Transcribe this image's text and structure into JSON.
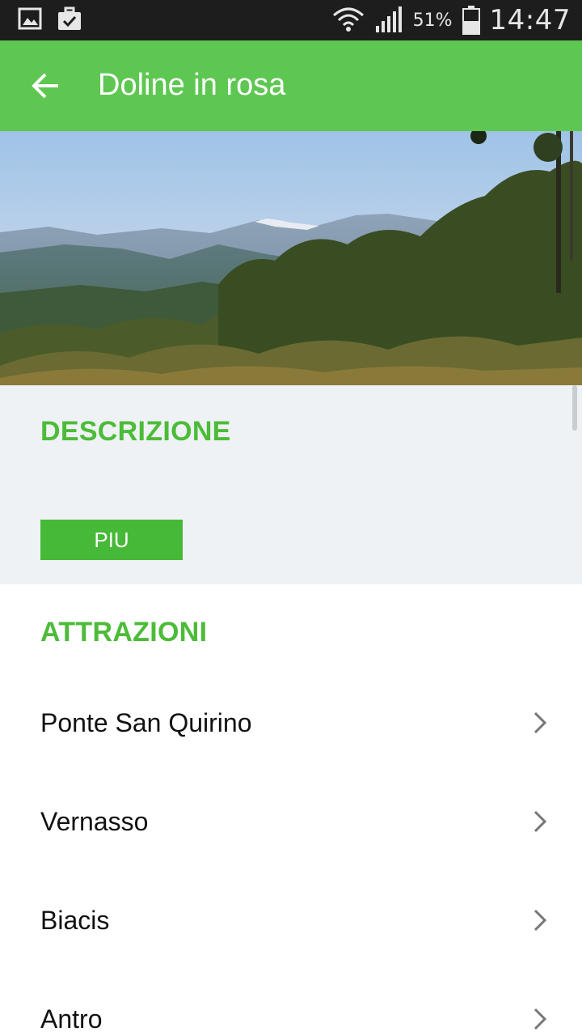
{
  "status_bar": {
    "battery_percent": "51%",
    "time": "14:47",
    "icons": [
      "image-notification-icon",
      "briefcase-check-icon",
      "wifi-icon",
      "signal-icon",
      "battery-icon"
    ]
  },
  "app_bar": {
    "title": "Doline in rosa",
    "back_icon": "arrow-left-icon",
    "color": "#5ec752"
  },
  "hero": {
    "alt": "mountain landscape"
  },
  "description": {
    "heading": "DESCRIZIONE",
    "more_button": "PIU"
  },
  "attractions": {
    "heading": "ATTRAZIONI",
    "items": [
      {
        "label": "Ponte San Quirino"
      },
      {
        "label": "Vernasso"
      },
      {
        "label": "Biacis"
      },
      {
        "label": "Antro"
      }
    ]
  },
  "colors": {
    "accent": "#4cbc38",
    "button": "#47b938",
    "section_bg": "#eef2f5"
  }
}
